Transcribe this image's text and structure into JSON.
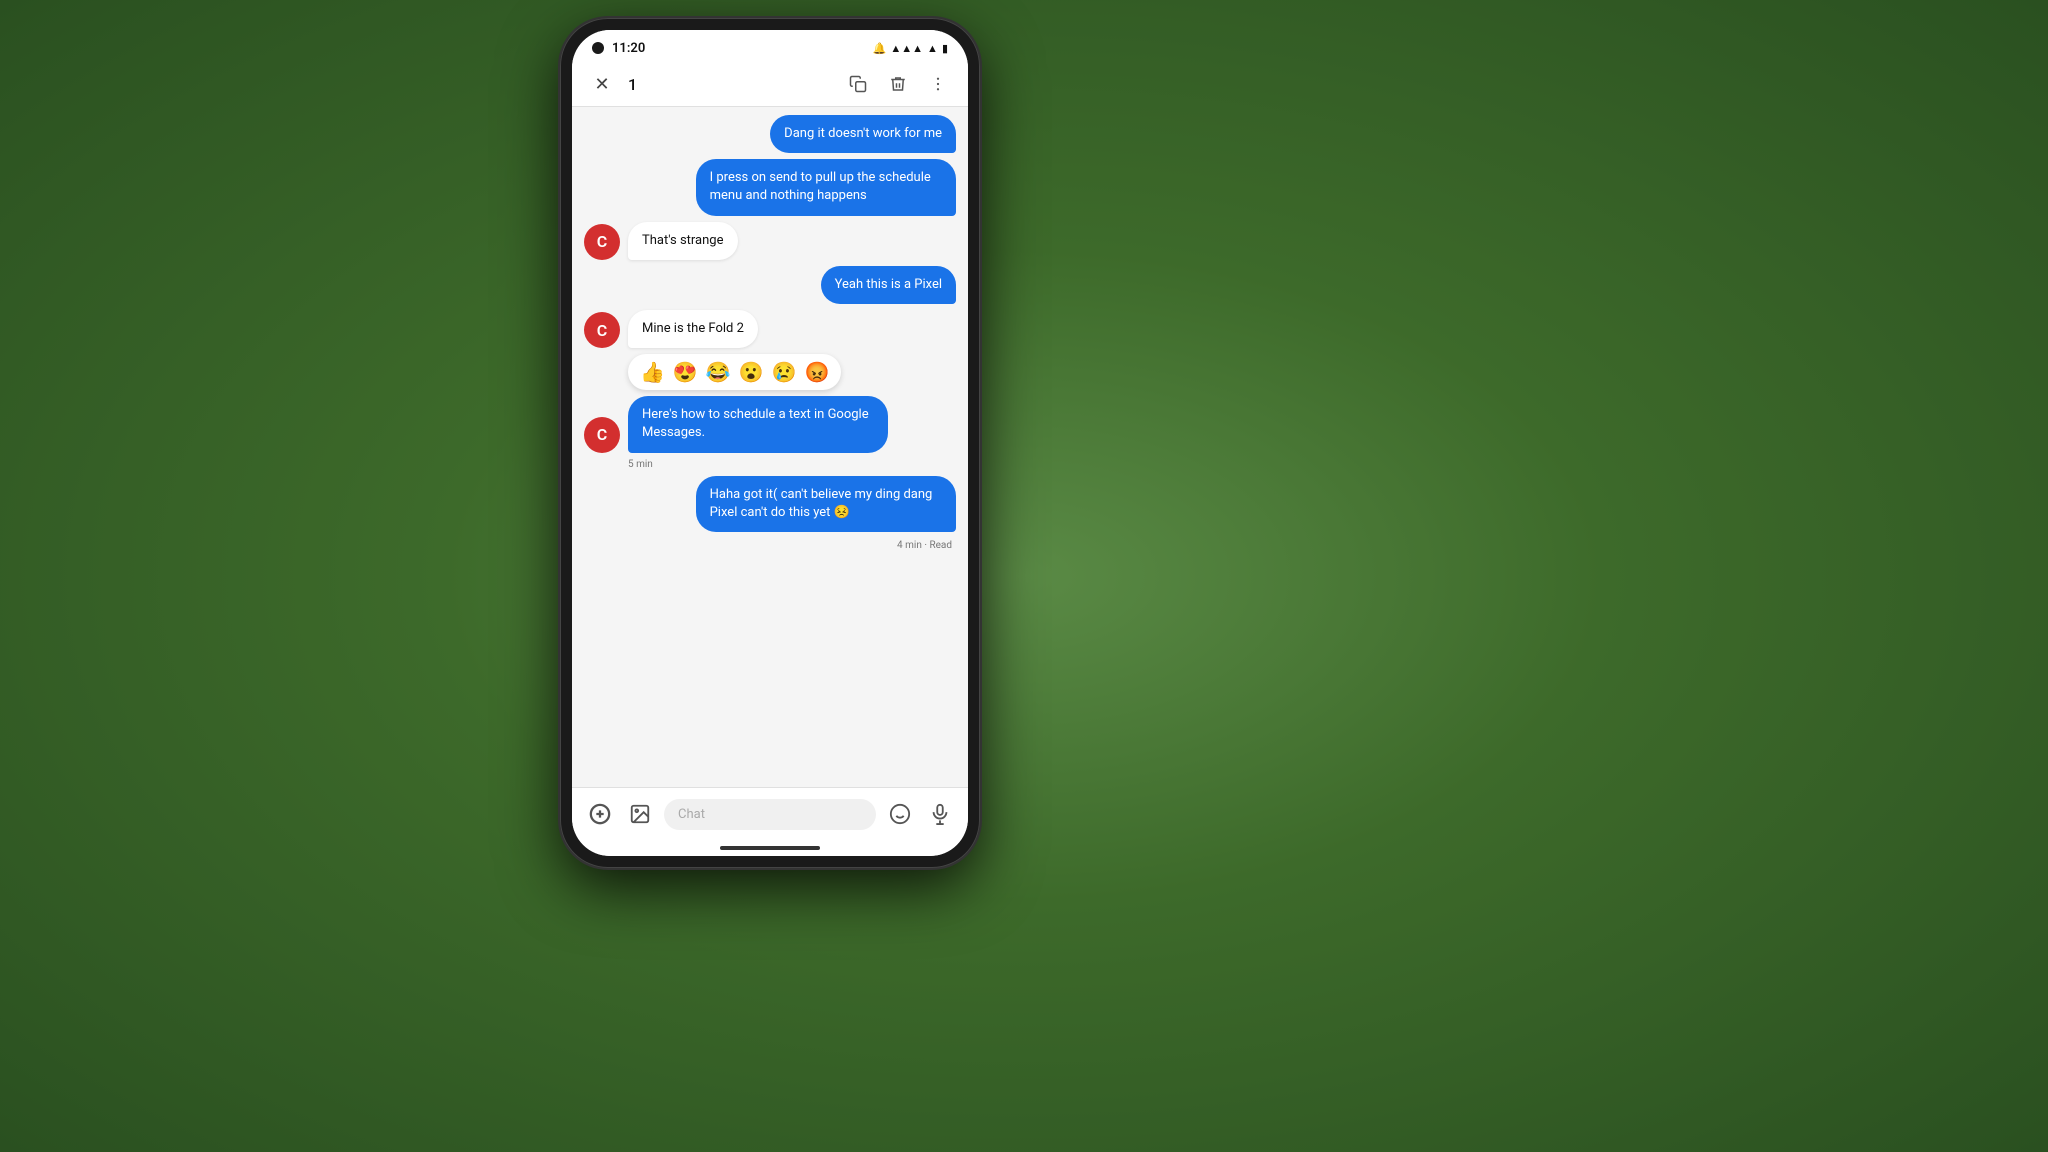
{
  "status": {
    "time": "11:20",
    "icons": [
      "🔔",
      "📶",
      "🔋"
    ]
  },
  "actionbar": {
    "close_label": "✕",
    "selection_count": "1",
    "copy_label": "⧉",
    "delete_label": "🗑",
    "more_label": "⋮"
  },
  "messages": [
    {
      "id": 1,
      "type": "outgoing",
      "text": "Dang it doesn't work for me",
      "meta": ""
    },
    {
      "id": 2,
      "type": "outgoing",
      "text": "I press on send to pull up the schedule menu and nothing happens",
      "meta": ""
    },
    {
      "id": 3,
      "type": "incoming",
      "text": "That's strange",
      "meta": ""
    },
    {
      "id": 4,
      "type": "outgoing",
      "text": "Yeah this is a Pixel",
      "meta": ""
    },
    {
      "id": 5,
      "type": "incoming",
      "text": "Mine is the Fold 2",
      "meta": ""
    },
    {
      "id": 6,
      "type": "emoji-bar",
      "emojis": [
        "👍",
        "😍",
        "😂",
        "😮",
        "😢",
        "😡"
      ]
    },
    {
      "id": 7,
      "type": "incoming-blue",
      "text": "Here's how to schedule a text in Google Messages.",
      "time_label": "5 min"
    },
    {
      "id": 8,
      "type": "outgoing",
      "text": "Haha got it( can't believe my ding dang Pixel can't do this yet 😣",
      "meta": "4 min · Read"
    }
  ],
  "input": {
    "placeholder": "Chat",
    "add_icon": "+",
    "image_icon": "🖼",
    "emoji_icon": "😊",
    "mic_icon": "🎤"
  },
  "contact_initial": "C"
}
